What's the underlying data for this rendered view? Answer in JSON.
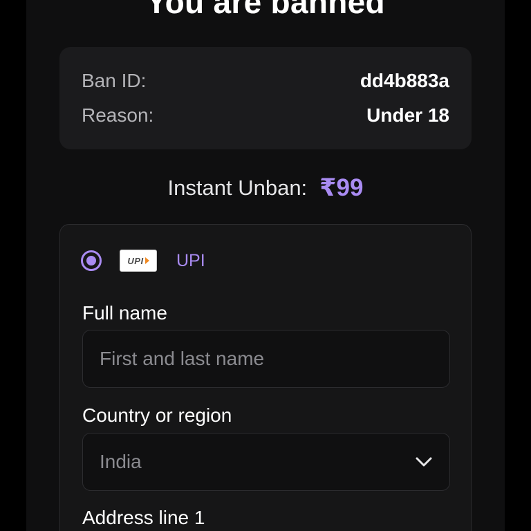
{
  "title": "You are banned",
  "ban_info": {
    "id_label": "Ban ID:",
    "id_value": "dd4b883a",
    "reason_label": "Reason:",
    "reason_value": "Under 18"
  },
  "unban": {
    "label": "Instant Unban:",
    "price": "₹99"
  },
  "payment": {
    "method_label": "UPI",
    "method_selected": true,
    "logo_text": "UPI",
    "fields": {
      "full_name_label": "Full name",
      "full_name_placeholder": "First and last name",
      "country_label": "Country or region",
      "country_value": "India",
      "address_label": "Address line 1"
    }
  },
  "colors": {
    "accent": "#a98bf2",
    "background": "#000000",
    "panel": "#0f0f10",
    "card": "#1b1b1d"
  },
  "icons": [
    "radio-selected-icon",
    "upi-logo-icon",
    "chevron-down-icon"
  ]
}
